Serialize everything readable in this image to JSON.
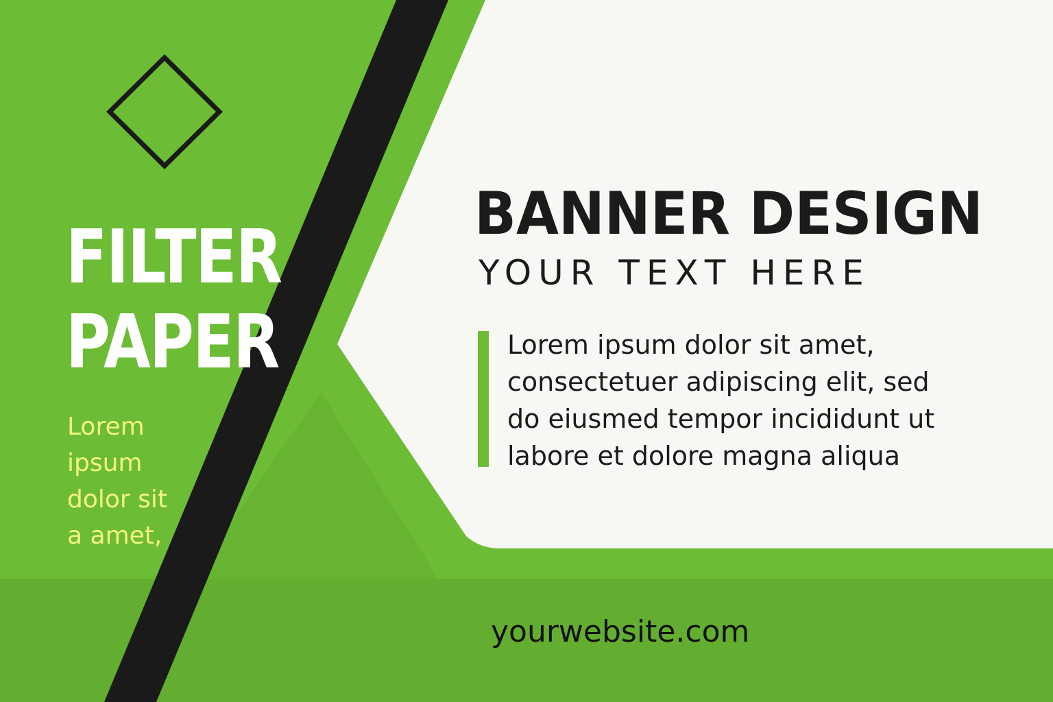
{
  "colors": {
    "green": "#6cbc36",
    "green_dark": "#5fa92e",
    "black_stripe": "#1a1a1a",
    "white_panel": "#f7f7f4",
    "yellow_text": "#f4f57d",
    "dark_text": "#1b1b1b"
  },
  "left_panel": {
    "title": "FILTER\nPAPER",
    "body": "Lorem ipsum dolor sit a amet,",
    "icon": "diamond-outline-icon"
  },
  "right_panel": {
    "headline": "BANNER DESIGN",
    "subheadline": "YOUR TEXT HERE",
    "body": "Lorem ipsum dolor sit amet,\nconsectetuer adipiscing elit, sed\ndo eiusmed tempor incididunt ut\nlabore et dolore magna aliqua"
  },
  "footer": {
    "website": "yourwebsite.com"
  }
}
